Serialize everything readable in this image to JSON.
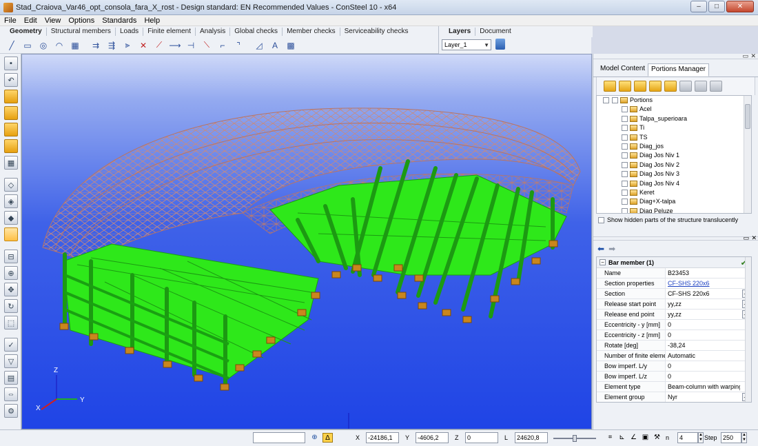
{
  "window": {
    "title": "Stad_Craiova_Var46_opt_consola_fara_X_rost - Design standard: EN Recommended Values - ConSteel 10 - x64",
    "buttons": {
      "minimize": "–",
      "maximize": "□",
      "close": "✕"
    }
  },
  "menu": [
    "File",
    "Edit",
    "View",
    "Options",
    "Standards",
    "Help"
  ],
  "ribbon_tabs": [
    "Geometry",
    "Structural members",
    "Loads",
    "Finite element",
    "Analysis",
    "Global checks",
    "Member checks",
    "Serviceability checks"
  ],
  "layers": {
    "tabs": [
      "Layers",
      "Document"
    ],
    "selected_layer": "Layer_1"
  },
  "right_panel": {
    "tabs": [
      "Model Content",
      "Portions Manager"
    ],
    "tree": {
      "root": "Portions",
      "items": [
        "Acel",
        "Talpa_superioara",
        "Ti",
        "TS",
        "Diag_jos",
        "Diag Jos Niv 1",
        "Diag Jos Niv 2",
        "Diag Jos Niv 3",
        "Diag Jos Niv 4",
        "Keret",
        "Diag+X-talpa",
        "Diag Peluze"
      ]
    },
    "show_hidden_label": "Show hidden parts of the structure translucently",
    "properties": {
      "header": "Bar member (1)",
      "rows": [
        {
          "key": "Name",
          "value": "B23453",
          "link": false,
          "dots": false
        },
        {
          "key": "Section properties",
          "value": "CF-SHS 220x6",
          "link": true,
          "dots": false
        },
        {
          "key": "Section",
          "value": "CF-SHS 220x6",
          "link": false,
          "dots": true
        },
        {
          "key": "Release start point",
          "value": "yy,zz",
          "link": false,
          "dots": true
        },
        {
          "key": "Release end point",
          "value": "yy,zz",
          "link": false,
          "dots": true
        },
        {
          "key": "Eccentricity - y [mm]",
          "value": "0",
          "link": false,
          "dots": false
        },
        {
          "key": "Eccentricity - z [mm]",
          "value": "0",
          "link": false,
          "dots": false
        },
        {
          "key": "Rotate [deg]",
          "value": "-38,24",
          "link": false,
          "dots": false
        },
        {
          "key": "Number of finite elements",
          "value": "Automatic",
          "link": false,
          "dots": false
        },
        {
          "key": "Bow imperf. L/y",
          "value": "0",
          "link": false,
          "dots": false
        },
        {
          "key": "Bow imperf. L/z",
          "value": "0",
          "link": false,
          "dots": false
        },
        {
          "key": "Element type",
          "value": "Beam-column with warping",
          "link": false,
          "dots": false
        },
        {
          "key": "Element group",
          "value": "Nyr",
          "link": false,
          "dots": true
        }
      ]
    }
  },
  "status": {
    "x_label": "X",
    "x_value": "-24186,1",
    "y_label": "Y",
    "y_value": "-4606,2",
    "z_label": "Z",
    "z_value": "0",
    "l_label": "L",
    "l_value": "24620,8",
    "n_label": "n",
    "n_value": "4",
    "step_label": "Step",
    "step_value": "250"
  },
  "axis_labels": {
    "x": "X",
    "y": "Y",
    "z": "Z"
  },
  "colors": {
    "viewport_top": "#cfd9f8",
    "viewport_bottom": "#1f44e6",
    "members_green": "#2ee81a",
    "roof_truss": "#c98a7c",
    "supports": "#b87a1a"
  }
}
